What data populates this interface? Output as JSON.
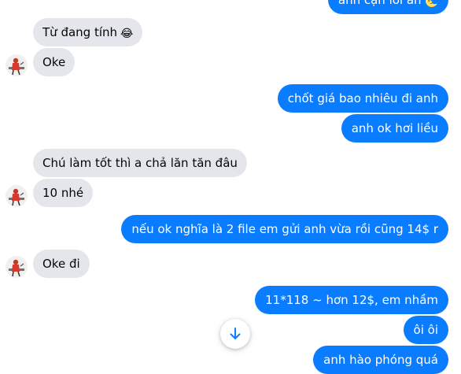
{
  "conversation": {
    "messages": [
      {
        "side": "out",
        "text": "anh cạn lời ah",
        "emoji": "🌜"
      },
      {
        "side": "in",
        "text": "Từ đang tính",
        "emoji": "😂"
      },
      {
        "side": "in",
        "text": "Oke"
      },
      {
        "side": "out",
        "text": "chốt giá bao nhiêu đi anh"
      },
      {
        "side": "out",
        "text": "anh ok hơi liều"
      },
      {
        "side": "in",
        "text": "Chú làm tốt thì a chả lăn tăn đâu"
      },
      {
        "side": "in",
        "text": "10 nhé"
      },
      {
        "side": "out",
        "text": "nếu ok  nghĩa là 2 file em gửi anh vừa rồi cũng 14$ r"
      },
      {
        "side": "in",
        "text": "Oke đi"
      },
      {
        "side": "out",
        "text": "11*118 ~  hơn 12$, em nhầm"
      },
      {
        "side": "out",
        "text": "ôi ôi"
      },
      {
        "side": "out",
        "text": "anh hào phóng quá"
      }
    ]
  },
  "controls": {
    "scroll_down_icon": "arrow-down-icon"
  },
  "colors": {
    "outgoing_bubble": "#0a7cff",
    "incoming_bubble": "#e4e6eb"
  }
}
